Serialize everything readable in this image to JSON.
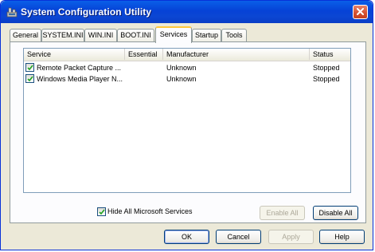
{
  "window": {
    "title": "System Configuration Utility"
  },
  "tabs": [
    {
      "label": "General"
    },
    {
      "label": "SYSTEM.INI"
    },
    {
      "label": "WIN.INI"
    },
    {
      "label": "BOOT.INI"
    },
    {
      "label": "Services",
      "active": true
    },
    {
      "label": "Startup"
    },
    {
      "label": "Tools"
    }
  ],
  "services": {
    "columns": [
      "Service",
      "Essential",
      "Manufacturer",
      "Status"
    ],
    "rows": [
      {
        "checked": true,
        "service": "Remote Packet Capture ...",
        "essential": "",
        "manufacturer": "Unknown",
        "status": "Stopped"
      },
      {
        "checked": true,
        "service": "Windows Media Player N...",
        "essential": "",
        "manufacturer": "Unknown",
        "status": "Stopped"
      }
    ],
    "hide_ms_label": "Hide All Microsoft Services",
    "hide_ms_checked": true,
    "enable_all_label": "Enable All",
    "disable_all_label": "Disable All"
  },
  "footer": {
    "ok_label": "OK",
    "cancel_label": "Cancel",
    "apply_label": "Apply",
    "help_label": "Help"
  }
}
